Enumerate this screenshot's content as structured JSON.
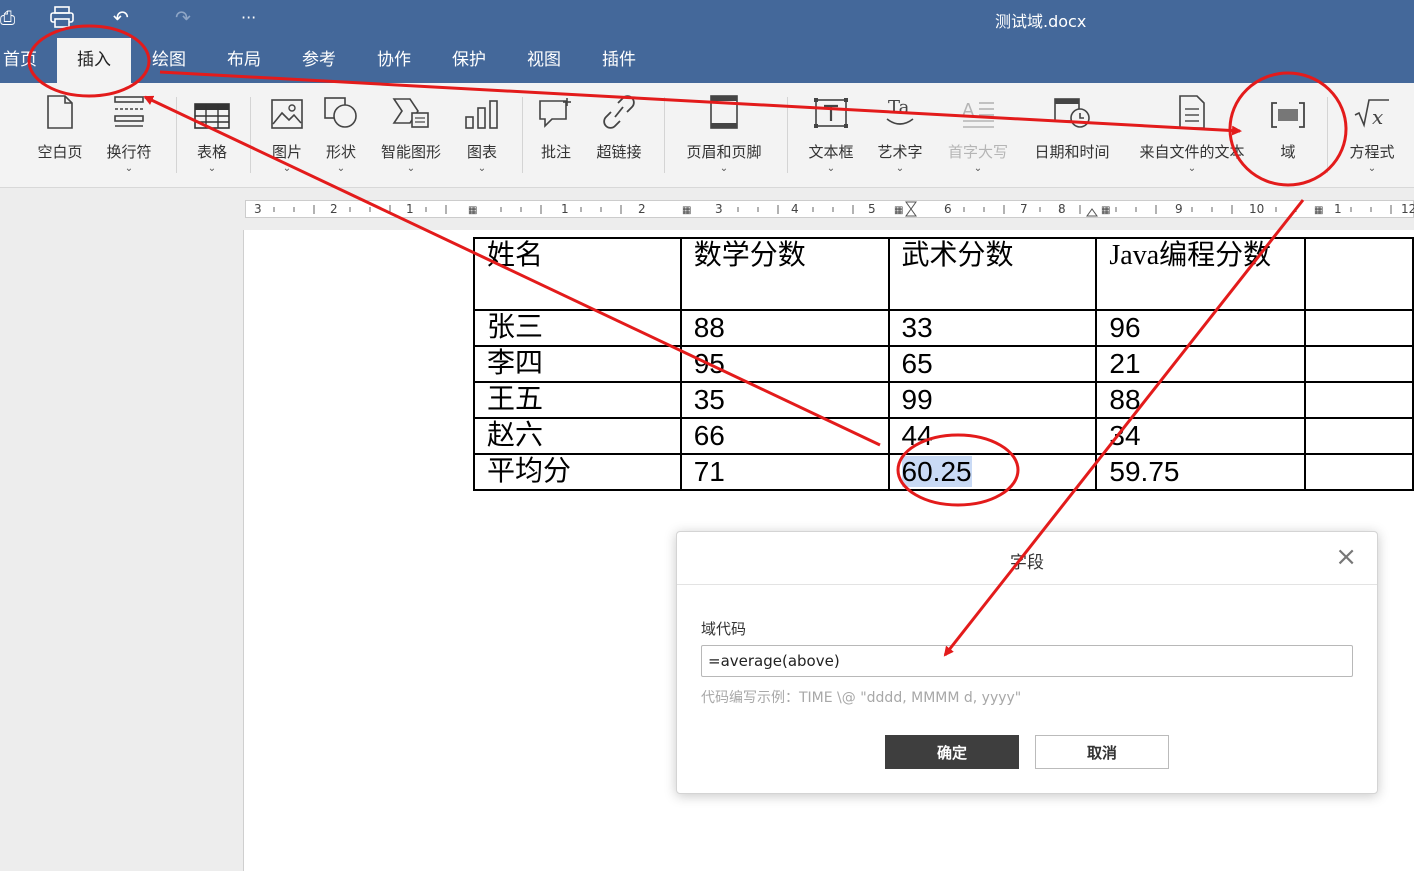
{
  "window": {
    "title": "测试域.docx",
    "quick_access": [
      "save-icon",
      "print-icon",
      "undo-icon",
      "redo-icon",
      "more-icon"
    ],
    "more_label": "···"
  },
  "menu": {
    "tabs": [
      {
        "label": "首页",
        "active": false
      },
      {
        "label": "插入",
        "active": true
      },
      {
        "label": "绘图",
        "active": false
      },
      {
        "label": "布局",
        "active": false
      },
      {
        "label": "参考",
        "active": false
      },
      {
        "label": "协作",
        "active": false
      },
      {
        "label": "保护",
        "active": false
      },
      {
        "label": "视图",
        "active": false
      },
      {
        "label": "插件",
        "active": false
      }
    ]
  },
  "ribbon": {
    "buttons": [
      {
        "label": "空白页",
        "icon": "blank-page-icon",
        "caret": false,
        "disabled": false
      },
      {
        "label": "换行符",
        "icon": "line-break-icon",
        "caret": true,
        "disabled": false
      },
      {
        "label": "表格",
        "icon": "table-icon",
        "caret": true,
        "disabled": false
      },
      {
        "label": "图片",
        "icon": "picture-icon",
        "caret": true,
        "disabled": false
      },
      {
        "label": "形状",
        "icon": "shape-icon",
        "caret": true,
        "disabled": false
      },
      {
        "label": "智能图形",
        "icon": "smartart-icon",
        "caret": true,
        "disabled": false
      },
      {
        "label": "图表",
        "icon": "chart-icon",
        "caret": true,
        "disabled": false
      },
      {
        "label": "批注",
        "icon": "comment-icon",
        "caret": false,
        "disabled": false
      },
      {
        "label": "超链接",
        "icon": "hyperlink-icon",
        "caret": false,
        "disabled": false
      },
      {
        "label": "页眉和页脚",
        "icon": "header-footer-icon",
        "caret": true,
        "disabled": false
      },
      {
        "label": "文本框",
        "icon": "textbox-icon",
        "caret": true,
        "disabled": false
      },
      {
        "label": "艺术字",
        "icon": "wordart-icon",
        "caret": true,
        "disabled": false
      },
      {
        "label": "首字大写",
        "icon": "dropcap-icon",
        "caret": true,
        "disabled": true
      },
      {
        "label": "日期和时间",
        "icon": "datetime-icon",
        "caret": false,
        "disabled": false
      },
      {
        "label": "来自文件的文本",
        "icon": "text-from-file-icon",
        "caret": true,
        "disabled": false
      },
      {
        "label": "域",
        "icon": "field-icon",
        "caret": false,
        "disabled": false
      },
      {
        "label": "方程式",
        "icon": "equation-icon",
        "caret": true,
        "disabled": false
      }
    ]
  },
  "ruler": {
    "numbers": [
      "3",
      "2",
      "1",
      "1",
      "2",
      "3",
      "4",
      "5",
      "6",
      "7",
      "8",
      "9",
      "10",
      "1",
      "12"
    ]
  },
  "table": {
    "header": [
      "姓名",
      "数学分数",
      "武术分数",
      "Java编程分数",
      ""
    ],
    "rows": [
      [
        "张三",
        "88",
        "33",
        "96",
        ""
      ],
      [
        "李四",
        "95",
        "65",
        "21",
        ""
      ],
      [
        "王五",
        "35",
        "99",
        "88",
        ""
      ],
      [
        "赵六",
        "66",
        "44",
        "34",
        ""
      ],
      [
        "平均分",
        "71",
        "60.25",
        "59.75",
        ""
      ]
    ]
  },
  "dialog": {
    "title": "字段",
    "close": "×",
    "field_label": "域代码",
    "field_value": "=average(above)",
    "hint": "代码编写示例：TIME \\@ \"dddd, MMMM d, yyyy\"",
    "ok": "确定",
    "cancel": "取消"
  },
  "colors": {
    "titlebar": "#44689a",
    "annotation": "#e31b1b",
    "selection": "#c9daf5"
  }
}
